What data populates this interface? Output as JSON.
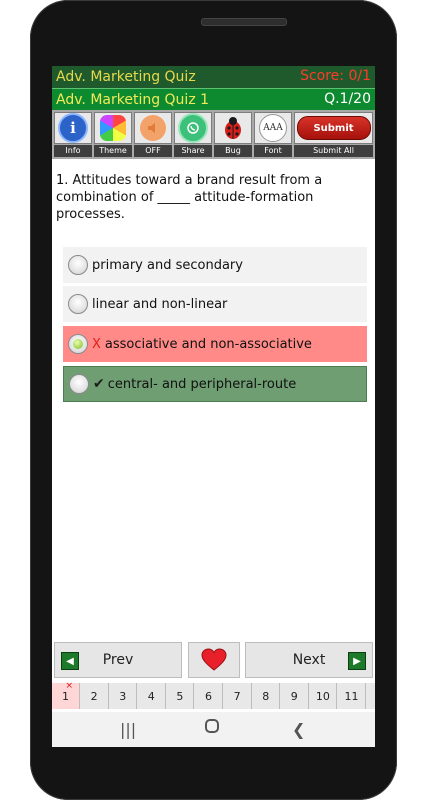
{
  "header": {
    "app_title": "Adv. Marketing Quiz",
    "score": "Score: 0/1"
  },
  "subheader": {
    "quiz_name": "Adv. Marketing Quiz 1",
    "question_number": "Q.1/20"
  },
  "toolbar": {
    "info": "Info",
    "theme": "Theme",
    "sound": "OFF",
    "share": "Share",
    "bug": "Bug",
    "font": "Font",
    "font_glyph": "AAA",
    "submit_button": "Submit",
    "submit_all": "Submit All"
  },
  "question": {
    "text": "1. Attitudes toward a brand result from a combination of _____ attitude-formation processes."
  },
  "options": [
    {
      "label": "primary and secondary",
      "state": "normal",
      "mark": ""
    },
    {
      "label": "linear and non-linear",
      "state": "normal",
      "mark": ""
    },
    {
      "label": "associative and non-associative",
      "state": "wrong",
      "mark": "X"
    },
    {
      "label": "central- and peripheral-route",
      "state": "correct",
      "mark": "✔"
    }
  ],
  "colors": {
    "wrong": "#ff8a87",
    "correct": "#6e9e72",
    "normal": "#f2f2f2"
  },
  "nav": {
    "prev": "Prev",
    "next": "Next"
  },
  "pages": [
    "1",
    "2",
    "3",
    "4",
    "5",
    "6",
    "7",
    "8",
    "9",
    "10",
    "11",
    "1"
  ],
  "page_marker": "×"
}
